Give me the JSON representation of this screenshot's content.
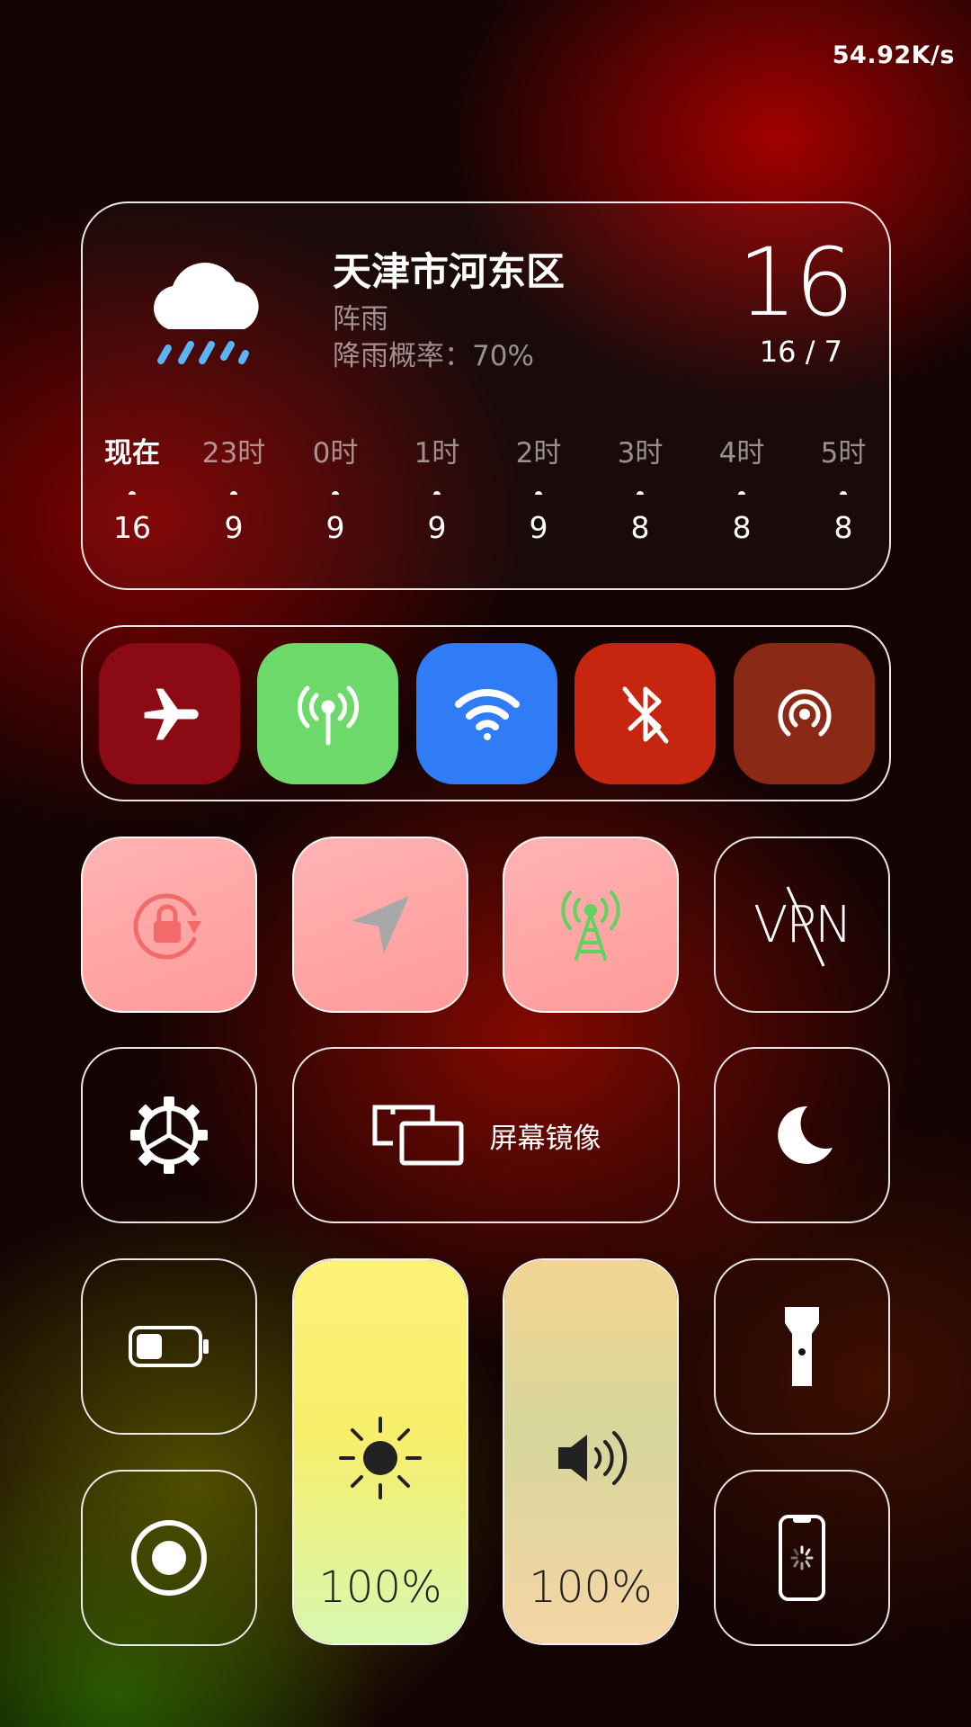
{
  "status": {
    "net_speed": "54.92K/s"
  },
  "weather": {
    "city": "天津市河东区",
    "condition": "阵雨",
    "rain_chance": "降雨概率：70%",
    "temp": "16",
    "range": "16 / 7",
    "hours": [
      {
        "label": "现在",
        "temp": "16"
      },
      {
        "label": "23时",
        "temp": "9"
      },
      {
        "label": "0时",
        "temp": "9"
      },
      {
        "label": "1时",
        "temp": "9"
      },
      {
        "label": "2时",
        "temp": "9"
      },
      {
        "label": "3时",
        "temp": "8"
      },
      {
        "label": "4时",
        "temp": "8"
      },
      {
        "label": "5时",
        "temp": "8"
      }
    ]
  },
  "connectivity": {
    "tiles": [
      {
        "name": "airplane",
        "icon": "airplane-icon",
        "color": "#8b0a14",
        "active": false
      },
      {
        "name": "cellular",
        "icon": "cellular-antenna-icon",
        "color": "#6cd96a",
        "active": true
      },
      {
        "name": "wifi",
        "icon": "wifi-icon",
        "color": "#2f7cf6",
        "active": true
      },
      {
        "name": "bluetooth",
        "icon": "bluetooth-off-icon",
        "color": "#c62510",
        "active": false
      },
      {
        "name": "airdrop",
        "icon": "airdrop-icon",
        "color": "#8a2a16",
        "active": false
      }
    ]
  },
  "toggles": {
    "vpn_label": "VPN",
    "screen_mirror_label": "屏幕镜像"
  },
  "sliders": {
    "brightness": {
      "label": "100%",
      "value": 1.0,
      "icon": "sun-icon"
    },
    "volume": {
      "label": "100%",
      "value": 1.0,
      "icon": "speaker-icon"
    }
  }
}
